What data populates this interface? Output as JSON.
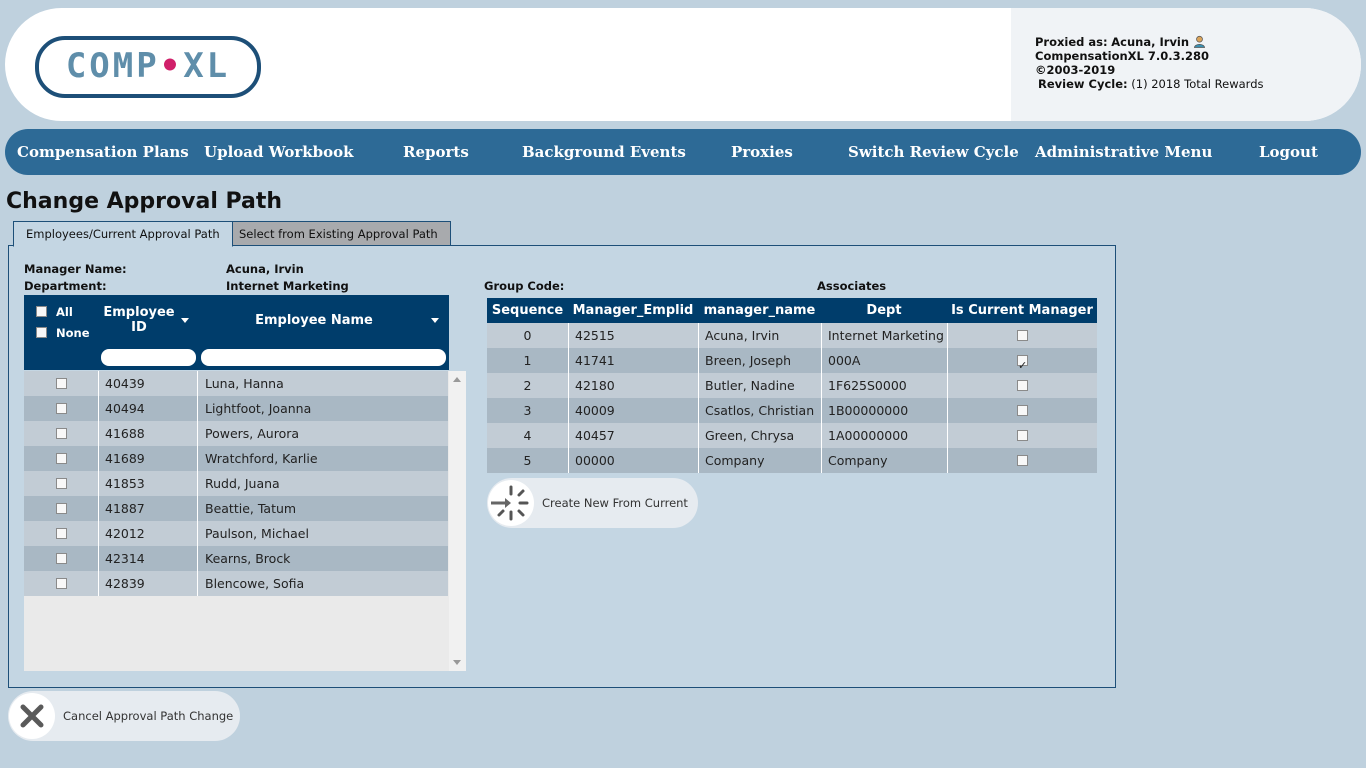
{
  "header": {
    "logo_text_a": "COMP",
    "logo_dot": "•",
    "logo_text_b": "XL",
    "proxied_label": "Proxied as:",
    "proxied_user": "Acuna, Irvin",
    "version": "CompensationXL 7.0.3.280",
    "copyright": "©2003-2019",
    "review_cycle_label": "Review Cycle:",
    "review_cycle_value": "(1) 2018 Total Rewards"
  },
  "nav": [
    {
      "label": "Compensation Plans"
    },
    {
      "label": "Upload Workbook"
    },
    {
      "label": "Reports"
    },
    {
      "label": "Background Events"
    },
    {
      "label": "Proxies"
    },
    {
      "label": "Switch Review Cycle"
    },
    {
      "label": "Administrative Menu"
    },
    {
      "label": "Logout"
    }
  ],
  "page_title": "Change Approval Path",
  "tabs": [
    {
      "label": "Employees/Current Approval Path",
      "active": true
    },
    {
      "label": "Select from Existing Approval Path",
      "active": false
    }
  ],
  "manager": {
    "name_label": "Manager Name:",
    "name_value": "Acuna, Irvin",
    "dept_label": "Department:",
    "dept_value": "Internet Marketing"
  },
  "group": {
    "label": "Group Code:",
    "value": "Associates"
  },
  "employee_grid": {
    "select_all": "All",
    "select_none": "None",
    "col_id": "Employee ID",
    "col_name": "Employee Name",
    "rows": [
      {
        "id": "40439",
        "name": "Luna, Hanna"
      },
      {
        "id": "40494",
        "name": "Lightfoot, Joanna"
      },
      {
        "id": "41688",
        "name": "Powers, Aurora"
      },
      {
        "id": "41689",
        "name": "Wratchford, Karlie"
      },
      {
        "id": "41853",
        "name": "Rudd, Juana"
      },
      {
        "id": "41887",
        "name": "Beattie, Tatum"
      },
      {
        "id": "42012",
        "name": "Paulson, Michael"
      },
      {
        "id": "42314",
        "name": "Kearns, Brock"
      },
      {
        "id": "42839",
        "name": "Blencowe, Sofia"
      }
    ]
  },
  "approval_table": {
    "headers": [
      "Sequence",
      "Manager_Emplid",
      "manager_name",
      "Dept",
      "Is Current Manager"
    ],
    "rows": [
      {
        "seq": "0",
        "emplid": "42515",
        "name": "Acuna, Irvin",
        "dept": "Internet Marketing",
        "current": false
      },
      {
        "seq": "1",
        "emplid": "41741",
        "name": "Breen, Joseph",
        "dept": "000A",
        "current": true
      },
      {
        "seq": "2",
        "emplid": "42180",
        "name": "Butler, Nadine",
        "dept": "1F625S0000",
        "current": false
      },
      {
        "seq": "3",
        "emplid": "40009",
        "name": "Csatlos, Christian",
        "dept": "1B00000000",
        "current": false
      },
      {
        "seq": "4",
        "emplid": "40457",
        "name": "Green, Chrysa",
        "dept": "1A00000000",
        "current": false
      },
      {
        "seq": "5",
        "emplid": "00000",
        "name": "Company",
        "dept": "Company",
        "current": false
      }
    ]
  },
  "buttons": {
    "create_new": "Create New From Current",
    "cancel": "Cancel Approval Path Change"
  },
  "colors": {
    "nav_bg": "#2d6a96",
    "grid_header": "#003d6b",
    "page_bg": "#bfd1de"
  }
}
